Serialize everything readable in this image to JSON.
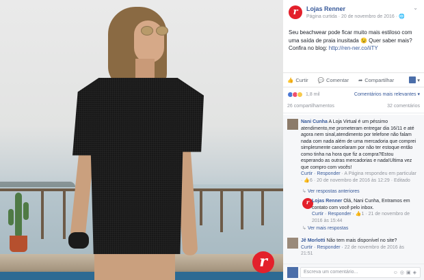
{
  "post": {
    "author": "Lojas Renner",
    "meta": "Página curtida · 20 de novembro de 2016 · 🌐",
    "text_line1": "Seu beachwear pode ficar muito mais estiloso com uma saída de praia inusitada 😉 Quer saber mais? Confira no blog: ",
    "link": "http://ren-ner.co/iiTY"
  },
  "watermark_letter": "r",
  "actions": {
    "like": "Curtir",
    "comment": "Comentar",
    "share": "Compartilhar"
  },
  "reactions": {
    "count": "1,8 mil",
    "relevance": "Comentários mais relevantes ▾"
  },
  "counts": {
    "shares": "26 compartilhamentos",
    "comments": "32 comentários"
  },
  "comments": [
    {
      "name": "Nani Cunha",
      "text": " A Loja Virtual é um péssimo atendimento,me prometeram entregar dia 16/11 e até agora nem sinal,atendimento por telefone não falam nada com nada além de uma mercadoria que comprei simplesmente cancelaram por não ter estoque então como tinha na hora que fiz a compra?Estou esperando as outras mercadorias e nada!Ultima vez que compro com vocês!",
      "reply_label": "Curtir · Responder",
      "page_replied": " · A Página respondeu em particular · ",
      "likes": "6",
      "date": " · 20 de novembro de 2016 às 12:29 · ",
      "edited": "Editado"
    },
    {
      "name": "Lojas Renner",
      "text": " Olá, Nani Cunha, Entramos em contato com você pelo inbox.",
      "reply_label": "Curtir · Responder · ",
      "likes": "1",
      "date": " · 21 de novembro de 2016 às 15:44"
    },
    {
      "name": "Jê Morlotti",
      "text": " Não tem mais disponível no site?",
      "reply_label": "Curtir · Responder · ",
      "date": "22 de novembro de 2016 às 21:51"
    }
  ],
  "reply_links": {
    "previous": "Ver respostas anteriores",
    "more": "Ver mais respostas"
  },
  "write_comment": {
    "placeholder": "Escreva um comentário..."
  }
}
